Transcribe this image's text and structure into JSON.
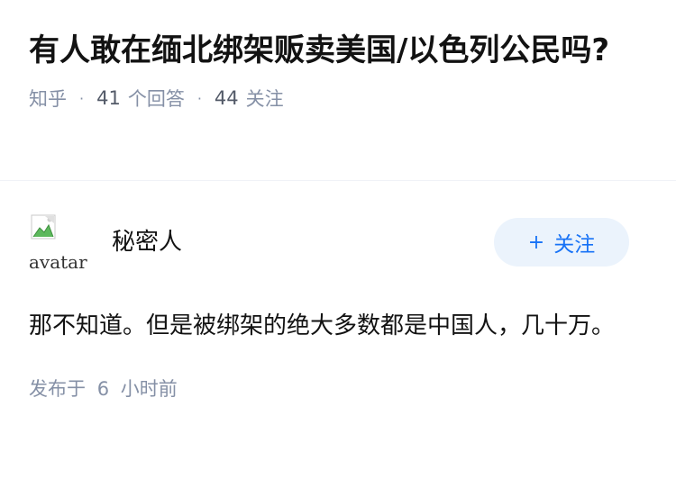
{
  "question": {
    "title": "有人敢在缅北绑架贩卖美国/以色列公民吗?",
    "source": "知乎",
    "answer_count": "41",
    "answer_label": "个回答",
    "follower_count": "44",
    "follower_label": "关注",
    "separator": "·"
  },
  "answer": {
    "avatar_alt": "avatar",
    "author_name": "秘密人",
    "follow_button": {
      "icon": "plus-icon",
      "icon_glyph": "+",
      "label": "关注"
    },
    "content": "那不知道。但是被绑架的绝大多数都是中国人，几十万。",
    "published_prefix": "发布于",
    "published_number": "6",
    "published_suffix": "小时前"
  },
  "colors": {
    "title": "#121212",
    "meta": "#8590a6",
    "accent": "#1772f6",
    "button_bg": "#ebf3fc",
    "divider": "#f0f2f7"
  }
}
